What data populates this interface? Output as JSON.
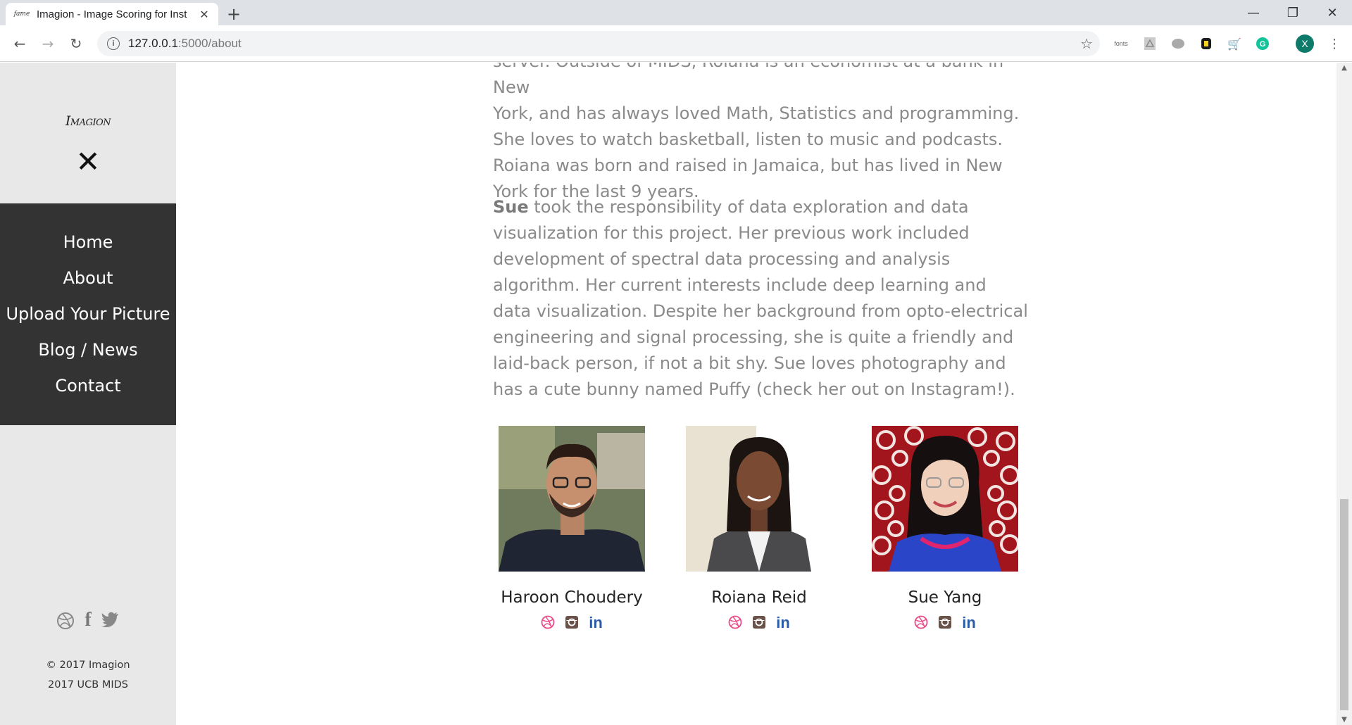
{
  "browser": {
    "tab_title": "Imagion - Image Scoring for Inst",
    "tab_favicon_text": "fame",
    "tab_close": "✕",
    "new_tab": "+",
    "url_host": "127.0.0.1",
    "url_rest": ":5000/about",
    "window_controls": [
      "—",
      "❐",
      "✕"
    ],
    "extensions": [
      "fonts",
      "acrobat-icon",
      "elephant-icon",
      "evernote-icon",
      "cart-icon",
      "grammarly-icon",
      "profile-avatar"
    ],
    "ext_fonts_label": "fonts",
    "profile_letter": "X"
  },
  "sidebar": {
    "logo": "Imagion",
    "close_icon": "✕",
    "menu": [
      "Home",
      "About",
      "Upload Your Picture",
      "Blog / News",
      "Contact"
    ],
    "copyright_line1": "© 2017 Imagion",
    "copyright_line2": "2017 UCB MIDS"
  },
  "content": {
    "para1_cut": "server. Outside of MIDS, Roiana is an economist at a bank in New",
    "para1": "York, and has always loved Math, Statistics and programming. She loves to watch basketball, listen to music and podcasts. Roiana was born and raised in Jamaica, but has lived in New York for the last 9 years.",
    "para2_name": "Sue",
    "para2": " took the responsibility of data exploration and data visualization for this project. Her previous work included development of spectral data processing and analysis algorithm. Her current interests include deep learning and data visualization. Despite her background from opto-electrical engineering and signal processing, she is quite a friendly and laid-back person, if not a bit shy. Sue loves photography and has a cute bunny named Puffy (check her out on Instagram!)."
  },
  "team": [
    {
      "name": "Haroon Choudery"
    },
    {
      "name": "Roiana Reid"
    },
    {
      "name": "Sue Yang"
    }
  ],
  "icons": {
    "dribbble": "⊛",
    "instagram": "◘",
    "linkedin": "in",
    "facebook": "f",
    "twitter": "🐦"
  },
  "colors": {
    "menu_bg": "#333333",
    "sidebar_bg": "#e8e8e8",
    "text_gray": "#8a8a8a",
    "dribbble": "#ea4c89",
    "linkedin": "#2a5aa8"
  }
}
